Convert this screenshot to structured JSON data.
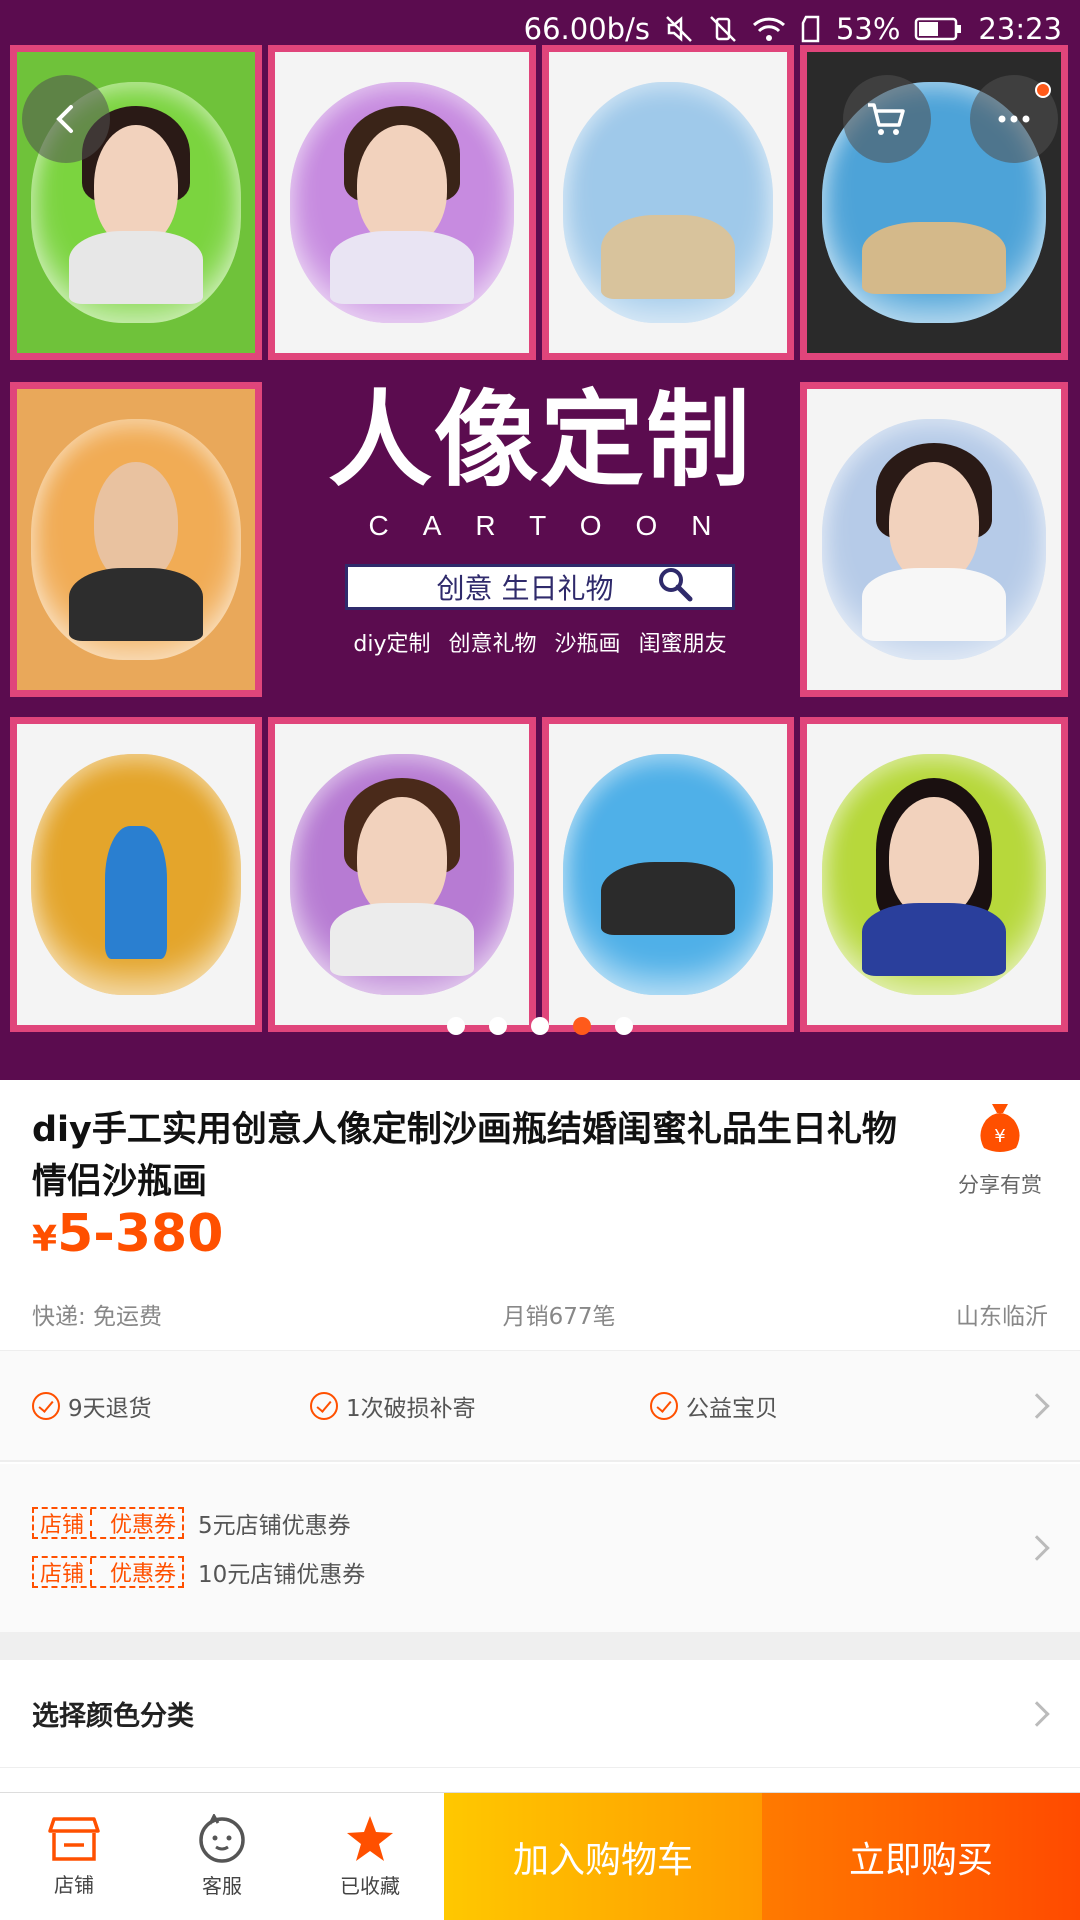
{
  "status_bar": {
    "speed": "66.00b/s",
    "battery_percent": "53%",
    "time": "23:23"
  },
  "hero": {
    "title_cn": "人像定制",
    "title_en": "CARTOON",
    "search_text": "创意 生日礼物",
    "tags": [
      "diy定制",
      "创意礼物",
      "沙瓶画",
      "闺蜜朋友"
    ],
    "carousel_total": 5,
    "carousel_active_index": 3,
    "background_color": "#5b0c4f",
    "frame_color": "#e0457b"
  },
  "product": {
    "title": "diy手工实用创意人像定制沙画瓶结婚闺蜜礼品生日礼物情侣沙瓶画",
    "currency": "¥",
    "price": "5-380",
    "share_label": "分享有赏",
    "shipping": "快递: 免运费",
    "monthly_sales": "月销677笔",
    "location": "山东临沂",
    "accent_color": "#ff5000"
  },
  "services": [
    "9天退货",
    "1次破损补寄",
    "公益宝贝"
  ],
  "coupons": {
    "badge_left": "店铺",
    "badge_right": "优惠券",
    "items": [
      "5元店铺优惠券",
      "10元店铺优惠券"
    ]
  },
  "select": {
    "label": "选择颜色分类"
  },
  "bottom_bar": {
    "shop_label": "店铺",
    "service_label": "客服",
    "favorite_label": "已收藏",
    "add_to_cart": "加入购物车",
    "buy_now": "立即购买"
  }
}
